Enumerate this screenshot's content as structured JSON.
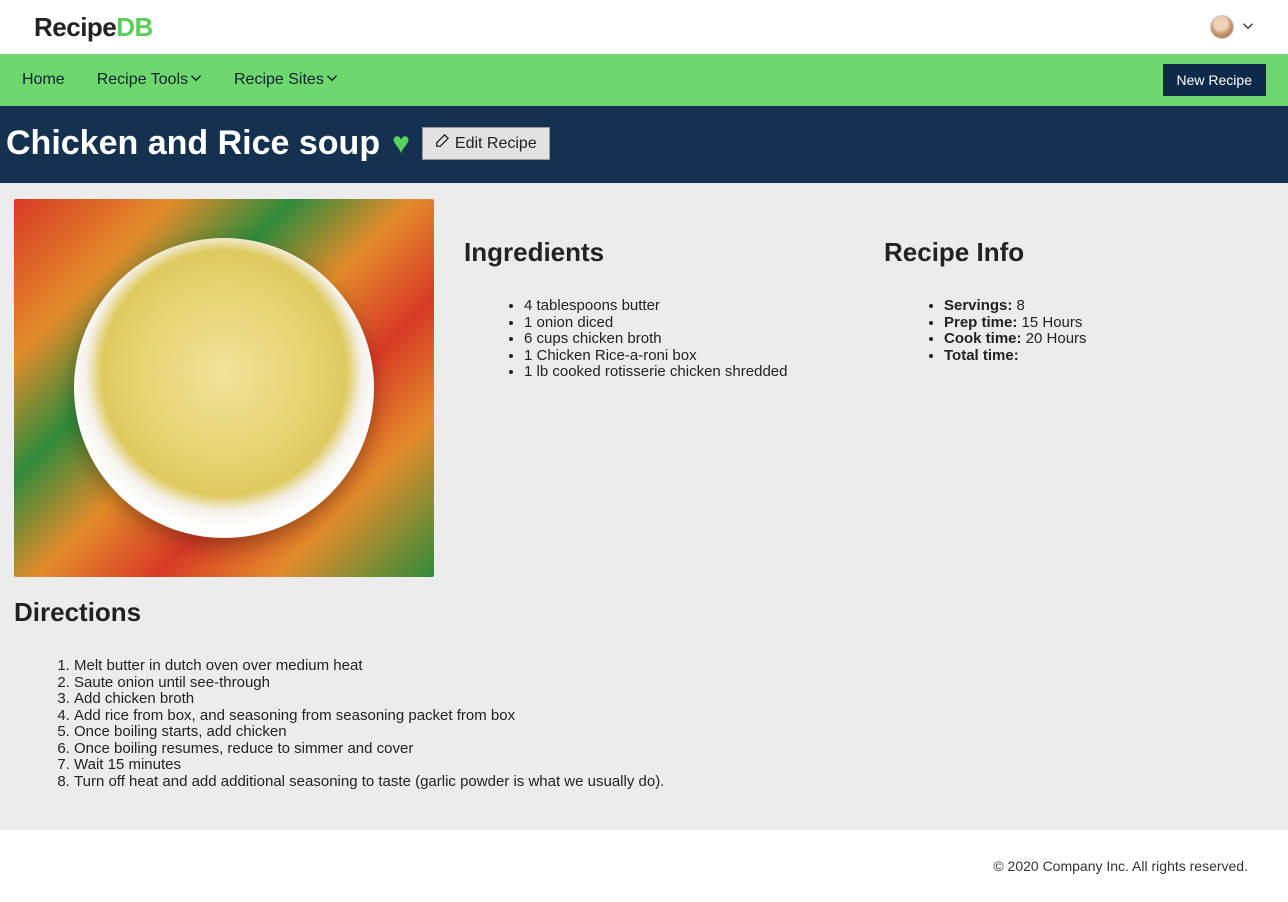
{
  "logo": {
    "part1": "Recipe",
    "part2": "DB"
  },
  "nav": {
    "home": "Home",
    "tools": "Recipe Tools",
    "sites": "Recipe Sites",
    "new": "New Recipe"
  },
  "title": "Chicken and Rice soup",
  "edit": "Edit Recipe",
  "headings": {
    "ingredients": "Ingredients",
    "info": "Recipe Info",
    "directions": "Directions"
  },
  "ingredients": [
    "4 tablespoons butter",
    "1 onion diced",
    "6 cups chicken broth",
    "1 Chicken Rice-a-roni box",
    "1 lb cooked rotisserie chicken shredded"
  ],
  "info": {
    "servings_label": "Servings:",
    "servings": " 8",
    "prep_label": "Prep time:",
    "prep": " 15 Hours",
    "cook_label": "Cook time:",
    "cook": " 20 Hours",
    "total_label": "Total time:",
    "total": ""
  },
  "directions": [
    "Melt butter in dutch oven over medium heat",
    "Saute onion until see-through",
    "Add chicken broth",
    "Add rice from box, and seasoning from seasoning packet from box",
    "Once boiling starts, add chicken",
    "Once boiling resumes, reduce to simmer and cover",
    "Wait 15 minutes",
    "Turn off heat and add additional seasoning to taste (garlic powder is what we usually do)."
  ],
  "footer": "© 2020 Company Inc. All rights reserved."
}
